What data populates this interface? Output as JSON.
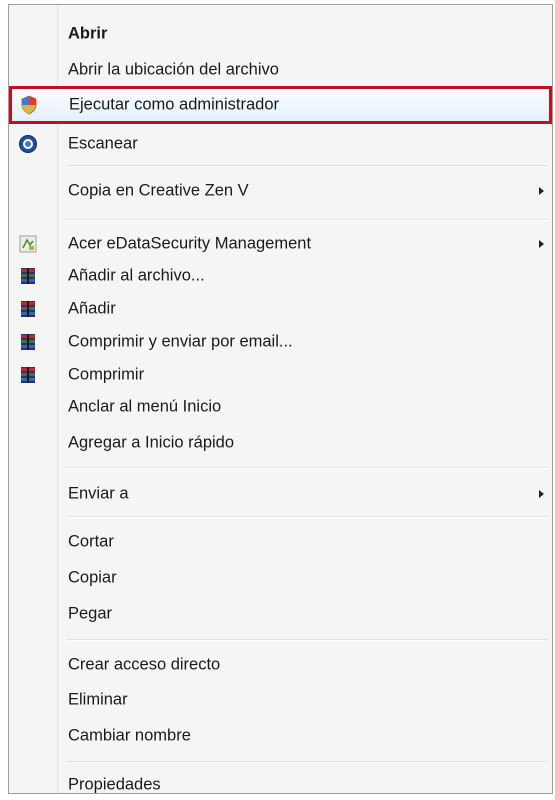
{
  "menu": {
    "items": [
      {
        "label": "Abrir",
        "icon": "",
        "submenu": false,
        "bold": true
      },
      {
        "label": "Abrir la ubicación del archivo",
        "icon": "",
        "submenu": false
      },
      {
        "label": "Ejecutar como administrador",
        "icon": "uac-shield-icon",
        "submenu": false,
        "highlighted": true
      },
      {
        "label": "Escanear",
        "icon": "antivirus-scan-icon",
        "submenu": false
      },
      {
        "label": "Copia en Creative Zen V",
        "icon": "",
        "submenu": true
      },
      {
        "label": "Acer eDataSecurity Management",
        "icon": "acer-edatasecurity-icon",
        "submenu": true
      },
      {
        "label": "Añadir al archivo...",
        "icon": "winrar-icon",
        "submenu": false
      },
      {
        "label": "Añadir",
        "icon": "winrar-icon",
        "submenu": false
      },
      {
        "label": "Comprimir y enviar por email...",
        "icon": "winrar-icon",
        "submenu": false
      },
      {
        "label": "Comprimir",
        "icon": "winrar-icon",
        "submenu": false
      },
      {
        "label": "Anclar al menú Inicio",
        "icon": "",
        "submenu": false
      },
      {
        "label": "Agregar a Inicio rápido",
        "icon": "",
        "submenu": false
      },
      {
        "label": "Enviar a",
        "icon": "",
        "submenu": true
      },
      {
        "label": "Cortar",
        "icon": "",
        "submenu": false
      },
      {
        "label": "Copiar",
        "icon": "",
        "submenu": false
      },
      {
        "label": "Pegar",
        "icon": "",
        "submenu": false
      },
      {
        "label": "Crear acceso directo",
        "icon": "",
        "submenu": false
      },
      {
        "label": "Eliminar",
        "icon": "",
        "submenu": false
      },
      {
        "label": "Cambiar nombre",
        "icon": "",
        "submenu": false
      },
      {
        "label": "Propiedades",
        "icon": "",
        "submenu": false
      }
    ]
  },
  "colors": {
    "highlight_border": "#c0111f",
    "menu_background": "#f5f5f5",
    "text": "#1a1a1a"
  }
}
